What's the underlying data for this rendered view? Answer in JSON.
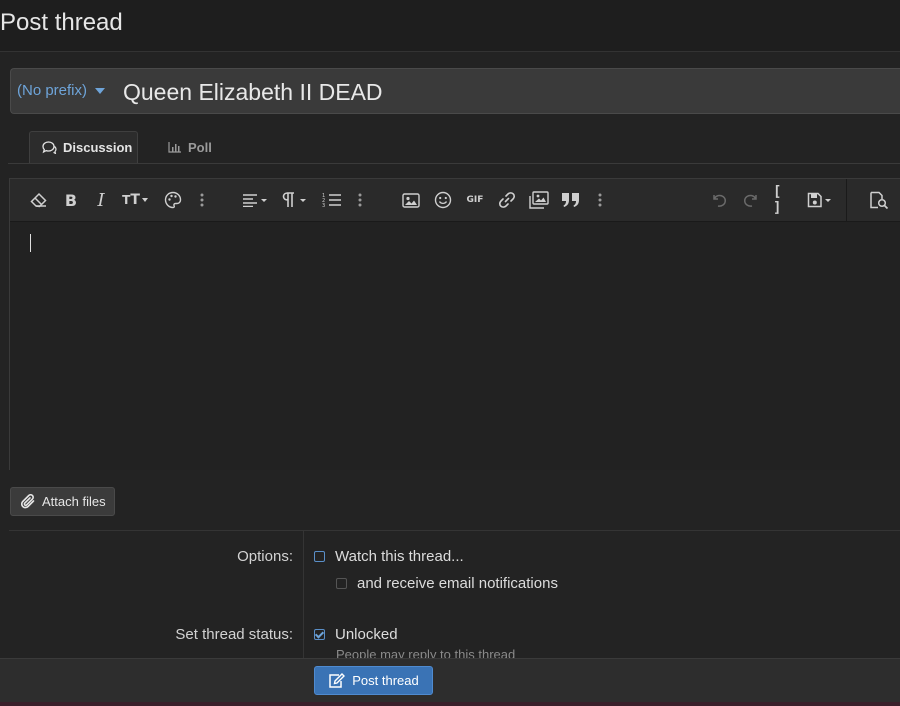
{
  "page": {
    "title": "Post thread"
  },
  "title_row": {
    "prefix": "(No prefix)",
    "thread_title": "Queen Elizabeth II DEAD"
  },
  "tabs": [
    {
      "label": "Discussion",
      "icon": "comments-icon",
      "active": true
    },
    {
      "label": "Poll",
      "icon": "bar-chart-icon",
      "active": false
    }
  ],
  "toolbar": {
    "items": [
      "eraser-icon",
      "bold-icon",
      "italic-icon",
      "text-size-icon",
      "palette-icon",
      "more-icon",
      "align-icon",
      "paragraph-icon",
      "list-icon",
      "more-icon",
      "image-icon",
      "smiley-icon",
      "gif-icon",
      "link-icon",
      "media-icon",
      "quote-icon",
      "more-icon",
      "undo-icon",
      "redo-icon",
      "bbcode-icon",
      "drafts-icon",
      "preview-icon"
    ],
    "gif_label": "GIF",
    "bbcode_label": "[ ]"
  },
  "attach": {
    "label": "Attach files"
  },
  "options": {
    "label": "Options:",
    "watch_label": "Watch this thread...",
    "email_label": "and receive email notifications"
  },
  "status": {
    "label": "Set thread status:",
    "unlocked_label": "Unlocked",
    "unlocked_hint": "People may reply to this thread"
  },
  "footer": {
    "submit_label": "Post thread"
  },
  "colors": {
    "accent": "#3a73b5",
    "link": "#6ea4d9",
    "background": "#232323"
  }
}
